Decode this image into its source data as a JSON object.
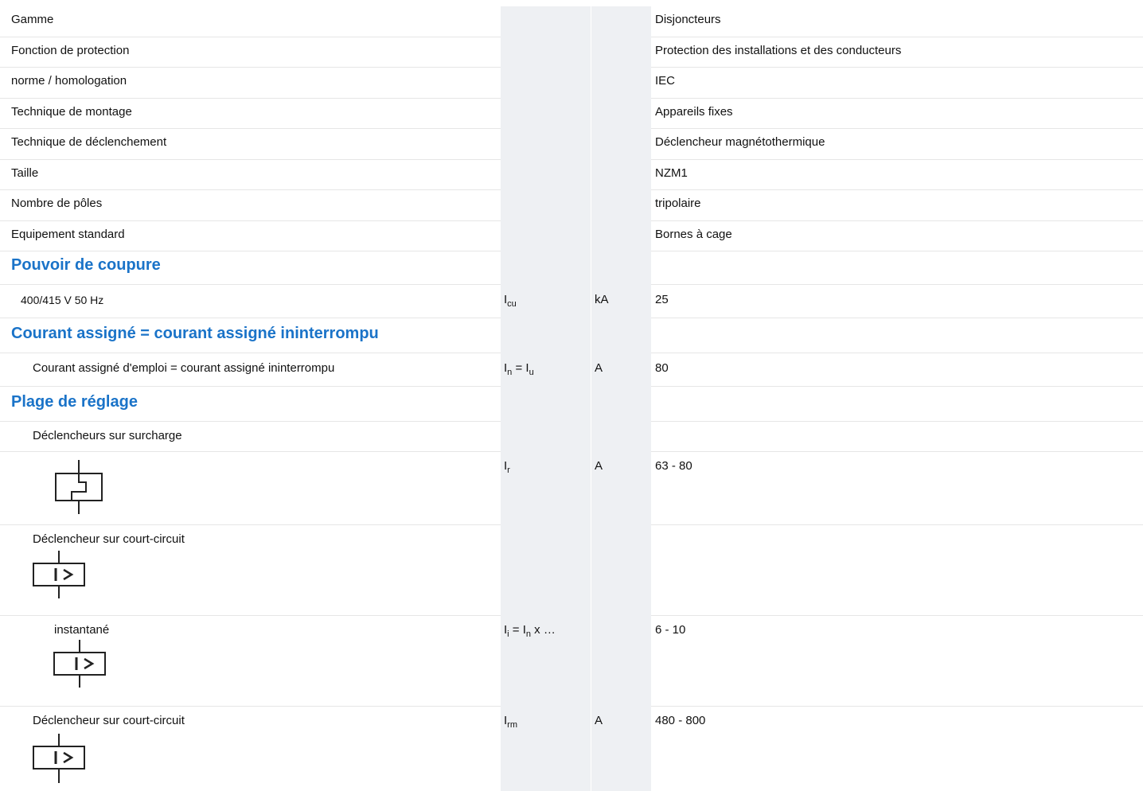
{
  "general": [
    {
      "label": "Gamme",
      "value": "Disjoncteurs"
    },
    {
      "label": "Fonction de protection",
      "value": "Protection des installations et des conducteurs"
    },
    {
      "label": "norme / homologation",
      "value": "IEC"
    },
    {
      "label": "Technique de montage",
      "value": "Appareils fixes"
    },
    {
      "label": "Technique de déclenchement",
      "value": "Déclencheur magnétothermique"
    },
    {
      "label": "Taille",
      "value": "NZM1"
    },
    {
      "label": "Nombre de pôles",
      "value": "tripolaire"
    },
    {
      "label": "Equipement standard",
      "value": "Bornes à cage"
    }
  ],
  "breaking": {
    "heading": "Pouvoir de coupure",
    "row": {
      "label": "400/415 V 50 Hz",
      "sym_main": "I",
      "sym_sub": "cu",
      "unit": "kA",
      "value": "25"
    }
  },
  "rated": {
    "heading": "Courant assigné = courant assigné ininterrompu",
    "row": {
      "label": "Courant assigné d'emploi = courant assigné ininterrompu",
      "sym_a": "I",
      "sym_a_sub": "n",
      "sym_b": " = I",
      "sym_b_sub": "u",
      "unit": "A",
      "value": "80"
    }
  },
  "setting": {
    "heading": "Plage de réglage",
    "overload_label": "Déclencheurs sur surcharge",
    "overload_row": {
      "sym_main": "I",
      "sym_sub": "r",
      "unit": "A",
      "value": "63 - 80",
      "icon": "thermal-trip-icon"
    },
    "short_label": "Déclencheur sur court-circuit",
    "instant_row": {
      "label": "instantané",
      "sym_a": "I",
      "sym_a_sub": "i",
      "sym_b": " = I",
      "sym_b_sub": "n",
      "sym_c": " x …",
      "value": "6 - 10",
      "icon": "magnetic-trip-icon"
    },
    "short2_row": {
      "label": "Déclencheur sur court-circuit",
      "sym_main": "I",
      "sym_sub": "rm",
      "unit": "A",
      "value": "480 - 800",
      "icon": "magnetic-trip-icon"
    }
  }
}
